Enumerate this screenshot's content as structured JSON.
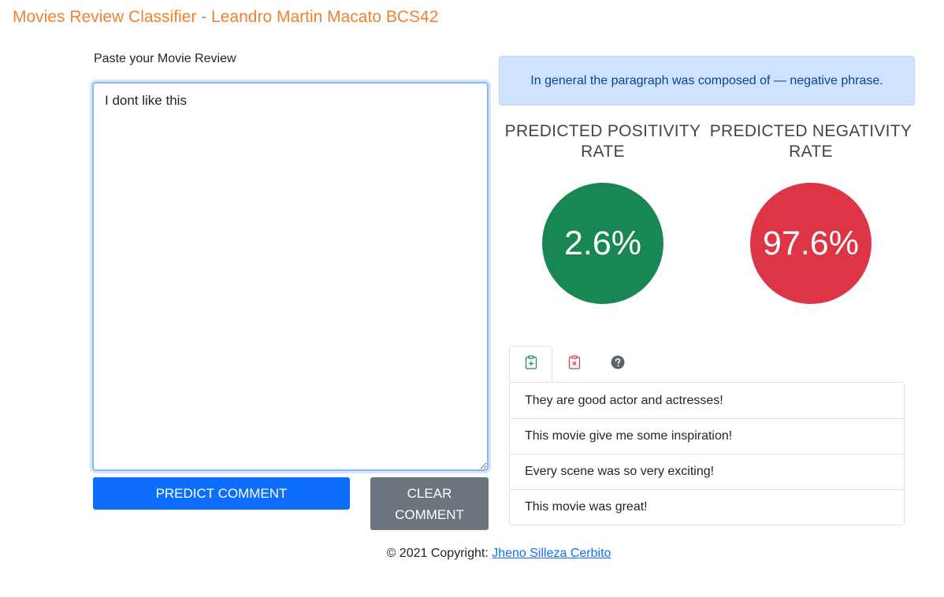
{
  "header": {
    "title": "Movies Review Classifier - Leandro Martin Macato BCS42"
  },
  "form": {
    "label": "Paste your Movie Review",
    "review_text": "I dont like this",
    "predict_label": "PREDICT COMMENT",
    "clear_label": "CLEAR COMMENT"
  },
  "result": {
    "summary": "In general the paragraph was composed of — negative phrase.",
    "positivity": {
      "title": "PREDICTED POSITIVITY RATE",
      "value": "2.6%",
      "color": "#198754"
    },
    "negativity": {
      "title": "PREDICTED NEGATIVITY RATE",
      "value": "97.6%",
      "color": "#dc3545"
    }
  },
  "tabs": [
    {
      "icon": "clipboard-plus-icon",
      "active": true
    },
    {
      "icon": "clipboard-x-icon",
      "active": false
    },
    {
      "icon": "question-circle-icon",
      "active": false
    }
  ],
  "positive_examples": [
    "They are good actor and actresses!",
    "This movie give me some inspiration!",
    "Every scene was so very exciting!",
    "This movie was great!"
  ],
  "footer": {
    "copyright": "© 2021 Copyright:",
    "author_link": "Jheno Silleza Cerbito"
  },
  "colors": {
    "brand": "#f0812f",
    "primary": "#0d6efd",
    "secondary": "#6c757d"
  }
}
